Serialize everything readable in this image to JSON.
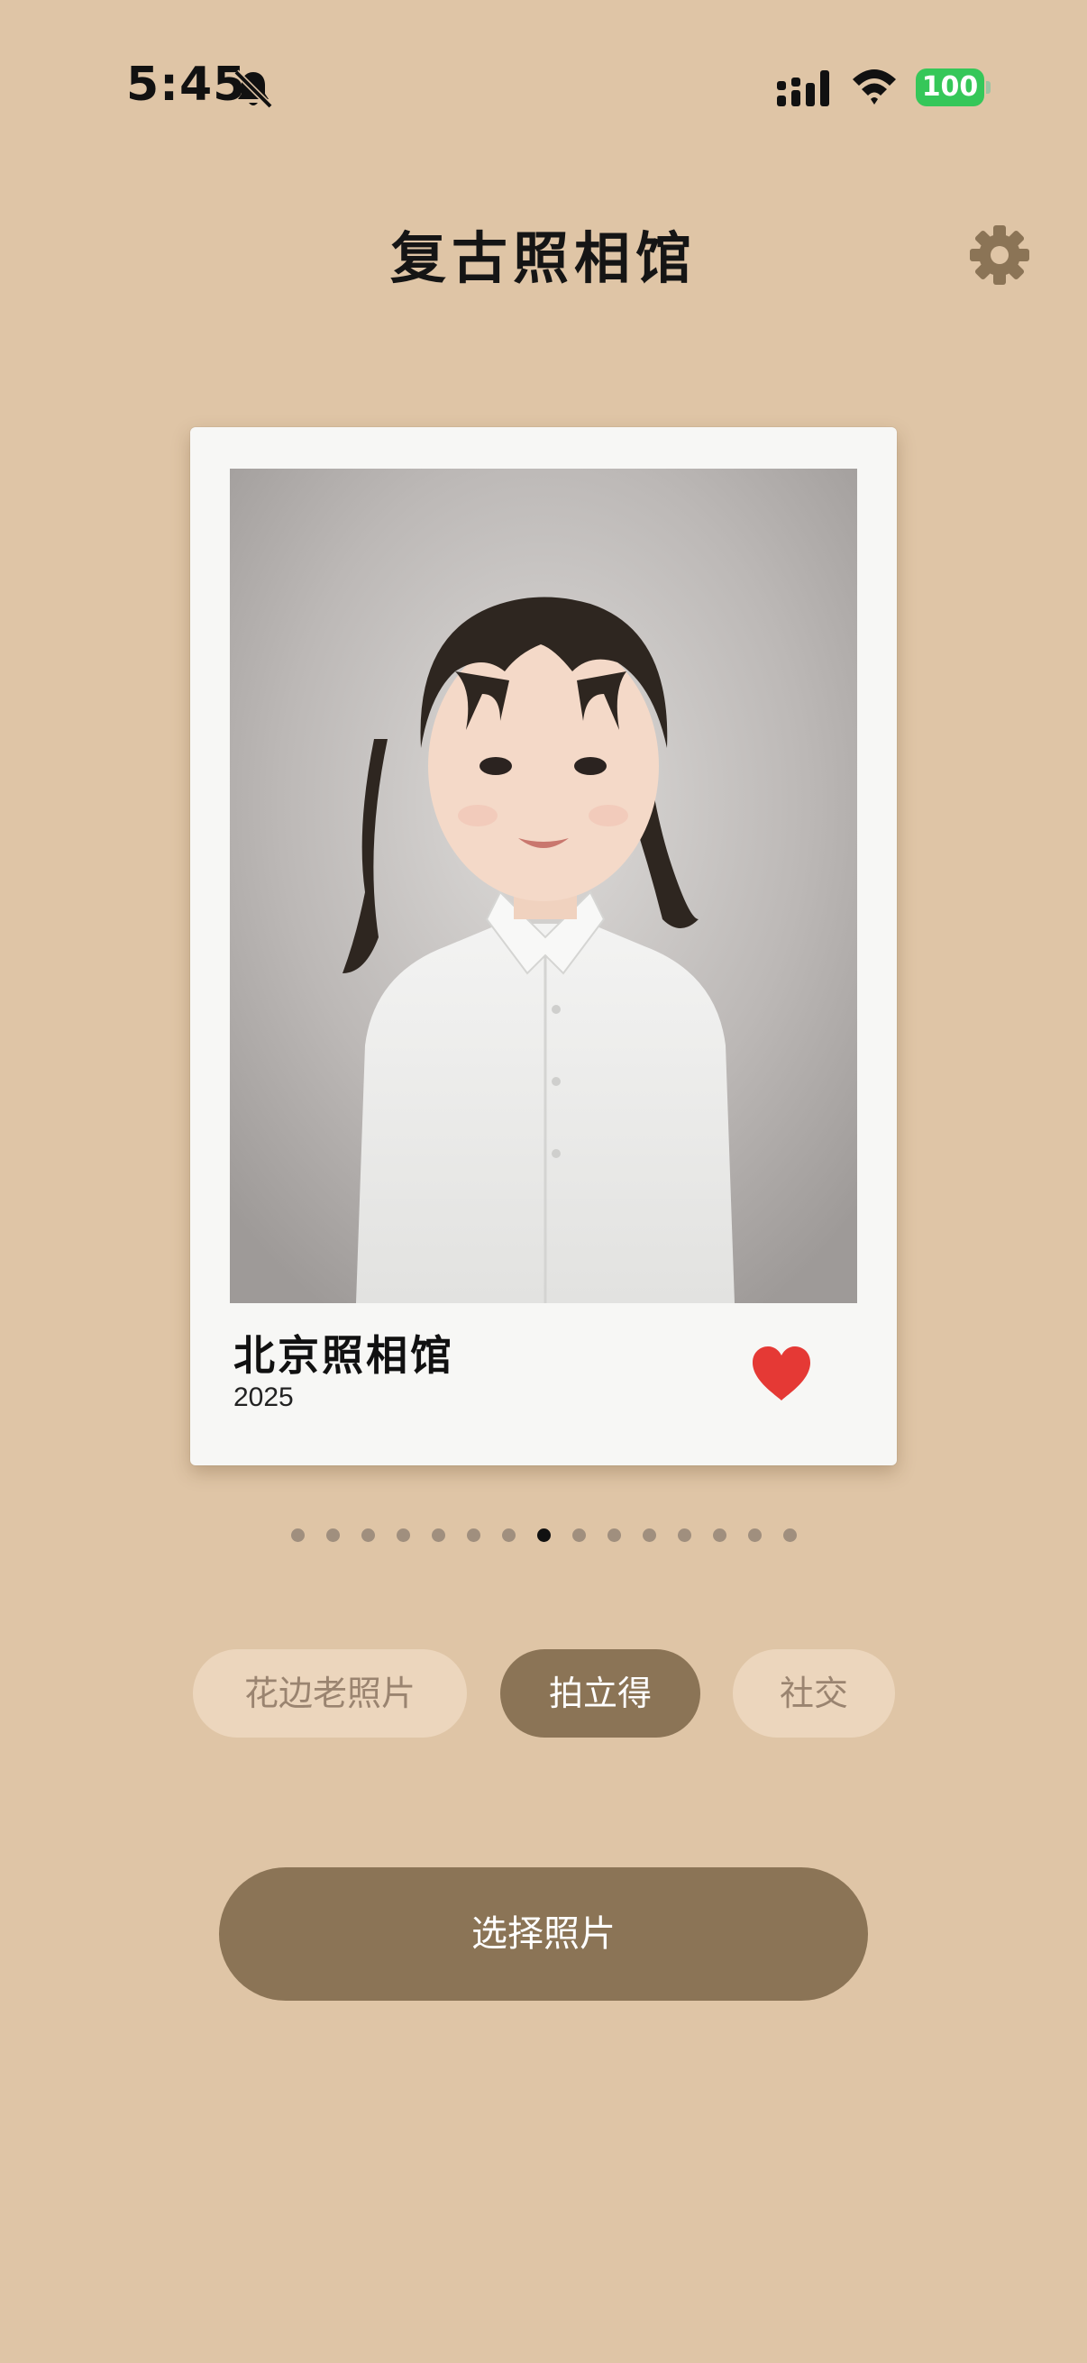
{
  "status_bar": {
    "time": "5:45",
    "battery_level": "100",
    "battery_color": "#35c759"
  },
  "header": {
    "title": "复古照相馆",
    "settings_icon": "gear-icon"
  },
  "card": {
    "caption_title": "北京照相馆",
    "caption_year": "2025",
    "favorite_icon": "heart-icon",
    "favorite_color": "#e53935"
  },
  "carousel": {
    "total_pages": 15,
    "active_index": 7
  },
  "tabs": [
    {
      "label": "花边老照片",
      "active": false
    },
    {
      "label": "拍立得",
      "active": true
    },
    {
      "label": "社交",
      "active": false
    }
  ],
  "primary_action": {
    "label": "选择照片"
  },
  "colors": {
    "background": "#dfc5a6",
    "accent": "#8b7456",
    "tab_inactive_bg": "#ecd6bd",
    "tab_inactive_text": "#9a8470"
  }
}
